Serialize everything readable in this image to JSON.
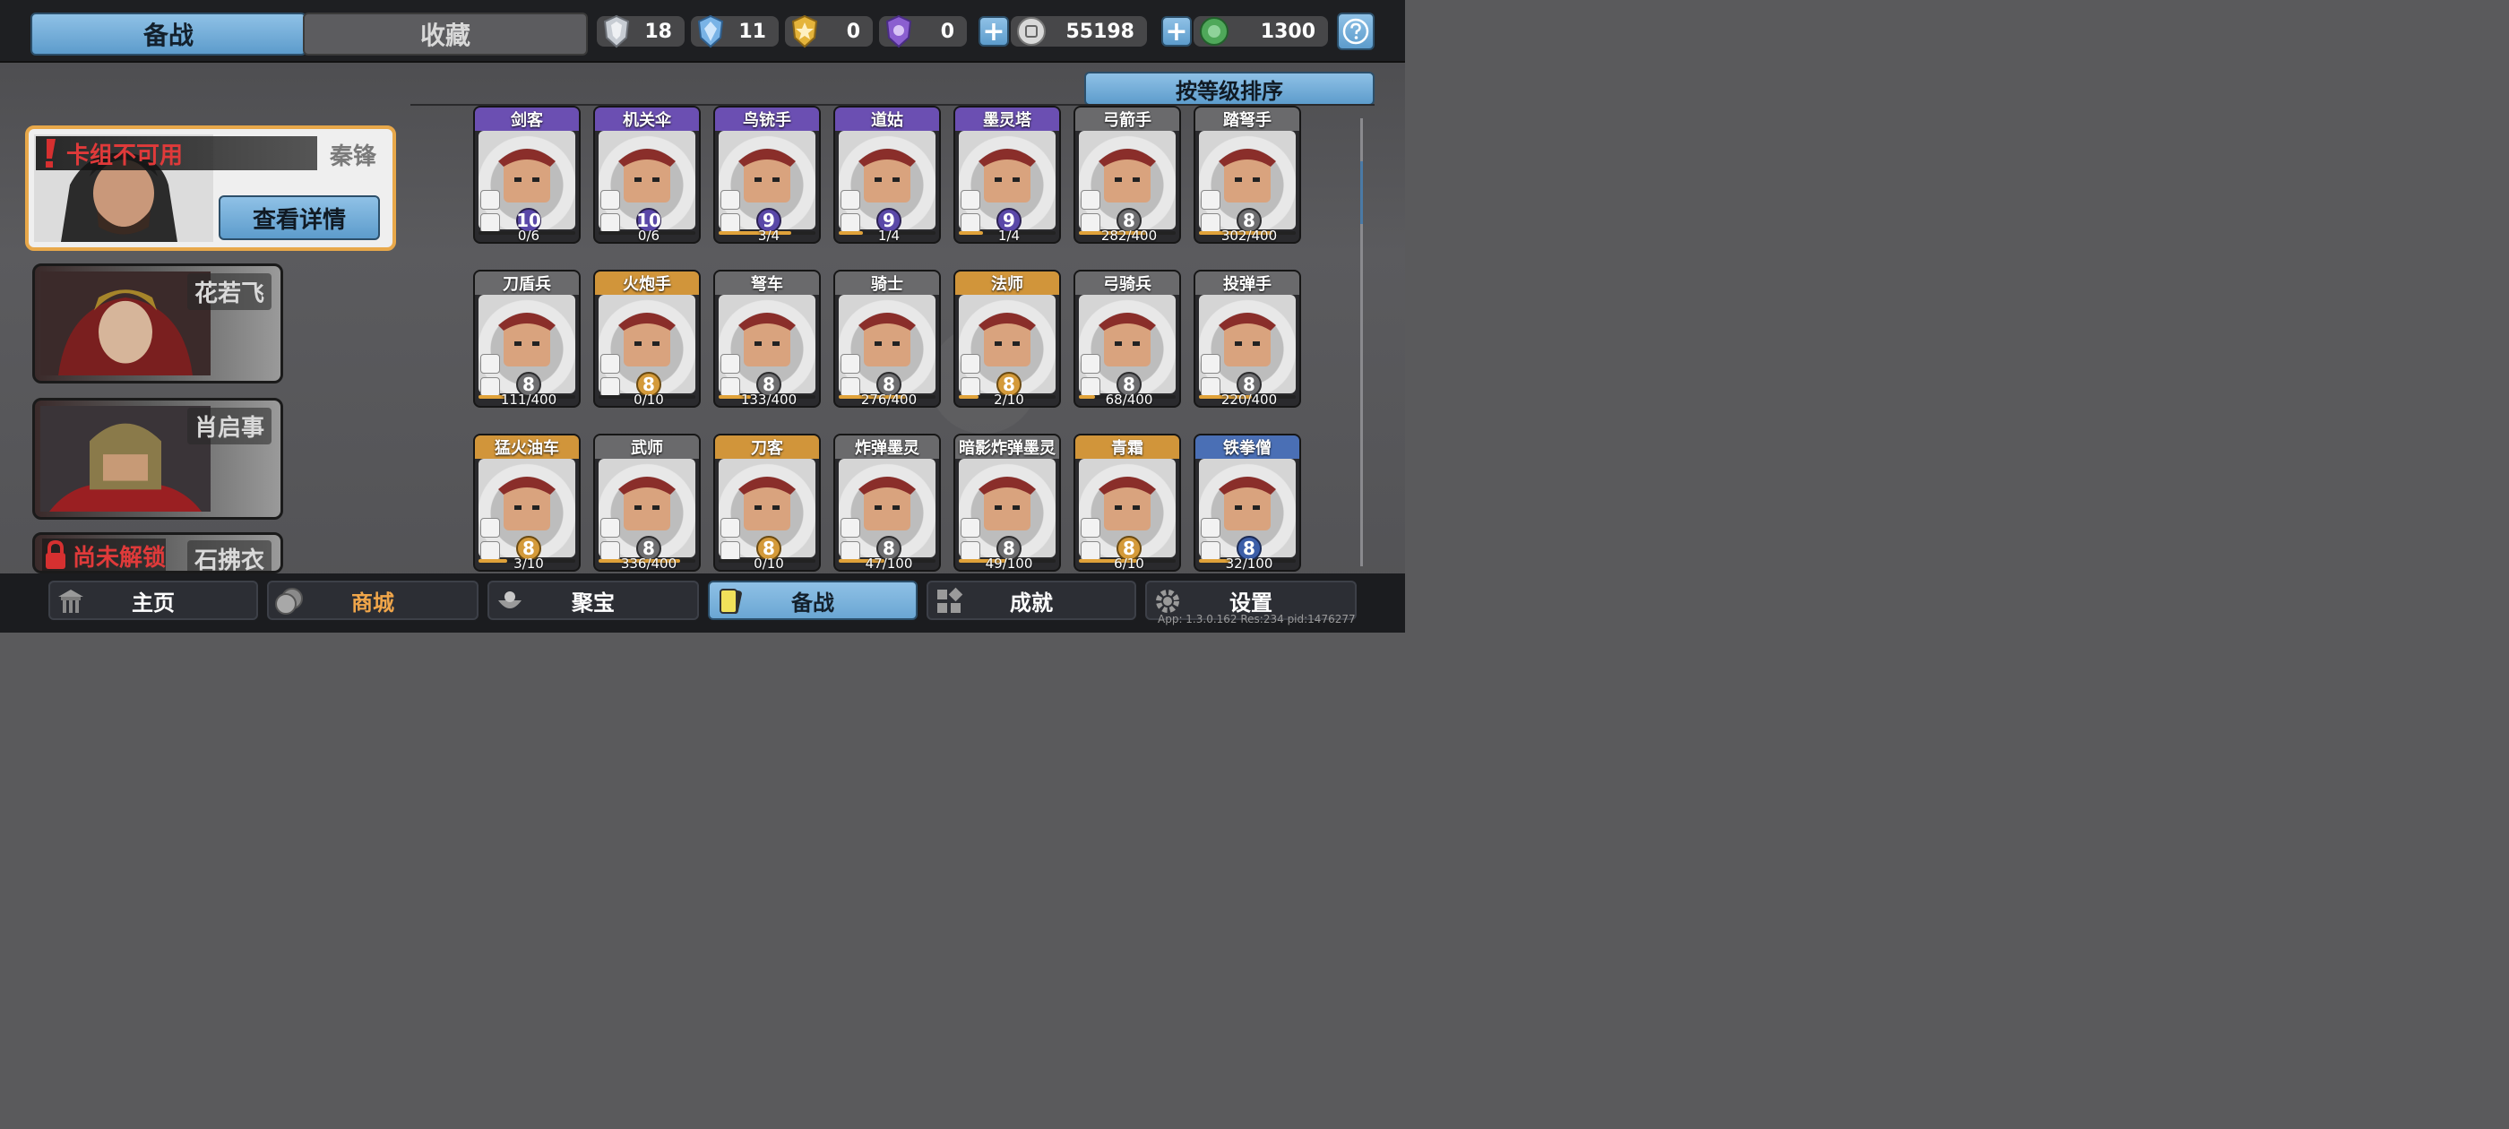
{
  "tabs": {
    "active": "备战",
    "inactive": "收藏"
  },
  "resources": [
    {
      "icon": "silver-shield-icon",
      "value": "18",
      "color": "#c7ccd3"
    },
    {
      "icon": "blue-crystal-icon",
      "value": "11",
      "color": "#79b3e6"
    },
    {
      "icon": "gold-badge-icon",
      "value": "0",
      "color": "#e5b43b"
    },
    {
      "icon": "purple-gem-icon",
      "value": "0",
      "color": "#8b5fd0"
    },
    {
      "icon": "silver-coin-icon",
      "value": "55198",
      "color": "#c9c9c9"
    },
    {
      "icon": "jade-coin-icon",
      "value": "1300",
      "color": "#4fa85a"
    }
  ],
  "sort_button": "按等级排序",
  "decks": [
    {
      "warning": "卡组不可用",
      "name": "秦锋",
      "button": "查看详情"
    },
    {
      "name": "花若飞"
    },
    {
      "name": "肖启事"
    },
    {
      "locked": "尚未解锁",
      "name": "石拂衣"
    }
  ],
  "units": [
    {
      "name": "剑客",
      "rarity": "purple",
      "level": "10",
      "progress": "0/6",
      "fill": 0.0
    },
    {
      "name": "机关伞",
      "rarity": "purple",
      "level": "10",
      "progress": "0/6",
      "fill": 0.0
    },
    {
      "name": "鸟铳手",
      "rarity": "purple",
      "level": "9",
      "progress": "3/4",
      "fill": 0.75
    },
    {
      "name": "道姑",
      "rarity": "purple",
      "level": "9",
      "progress": "1/4",
      "fill": 0.25
    },
    {
      "name": "墨灵塔",
      "rarity": "purple",
      "level": "9",
      "progress": "1/4",
      "fill": 0.25
    },
    {
      "name": "弓箭手",
      "rarity": "gray",
      "level": "8",
      "progress": "282/400",
      "fill": 0.705
    },
    {
      "name": "踏弩手",
      "rarity": "gray",
      "level": "8",
      "progress": "302/400",
      "fill": 0.755
    },
    {
      "name": "刀盾兵",
      "rarity": "gray",
      "level": "8",
      "progress": "111/400",
      "fill": 0.2775
    },
    {
      "name": "火炮手",
      "rarity": "gold",
      "level": "8",
      "progress": "0/10",
      "fill": 0.0
    },
    {
      "name": "弩车",
      "rarity": "gray",
      "level": "8",
      "progress": "133/400",
      "fill": 0.3325
    },
    {
      "name": "骑士",
      "rarity": "gray",
      "level": "8",
      "progress": "276/400",
      "fill": 0.69
    },
    {
      "name": "法师",
      "rarity": "gold",
      "level": "8",
      "progress": "2/10",
      "fill": 0.2
    },
    {
      "name": "弓骑兵",
      "rarity": "gray",
      "level": "8",
      "progress": "68/400",
      "fill": 0.17
    },
    {
      "name": "投弹手",
      "rarity": "gray",
      "level": "8",
      "progress": "220/400",
      "fill": 0.55
    },
    {
      "name": "猛火油车",
      "rarity": "gold",
      "level": "8",
      "progress": "3/10",
      "fill": 0.3
    },
    {
      "name": "武师",
      "rarity": "gray",
      "level": "8",
      "progress": "336/400",
      "fill": 0.84
    },
    {
      "name": "刀客",
      "rarity": "gold",
      "level": "8",
      "progress": "0/10",
      "fill": 0.0
    },
    {
      "name": "炸弹墨灵",
      "rarity": "gray",
      "level": "8",
      "progress": "47/100",
      "fill": 0.47
    },
    {
      "name": "暗影炸弹墨灵",
      "rarity": "gray",
      "level": "8",
      "progress": "49/100",
      "fill": 0.49
    },
    {
      "name": "青霜",
      "rarity": "gold",
      "level": "8",
      "progress": "6/10",
      "fill": 0.6
    },
    {
      "name": "铁拳僧",
      "rarity": "blue",
      "level": "8",
      "progress": "32/100",
      "fill": 0.32
    }
  ],
  "nav": {
    "home": "主页",
    "shop": "商城",
    "treasure": "聚宝",
    "prepare": "备战",
    "achievements": "成就",
    "settings": "设置"
  },
  "version": "App: 1.3.0.162 Res:234 pid:1476277"
}
